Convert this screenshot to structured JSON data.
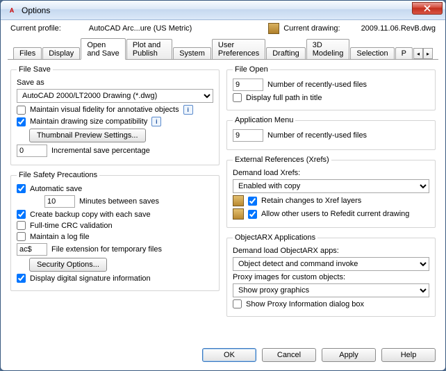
{
  "window": {
    "title": "Options"
  },
  "profile": {
    "current_label": "Current profile:",
    "current_value": "AutoCAD Arc...ure (US Metric)",
    "drawing_label": "Current drawing:",
    "drawing_value": "2009.11.06.RevB.dwg"
  },
  "tabs": {
    "files": "Files",
    "display": "Display",
    "open_save": "Open and Save",
    "plot_publish": "Plot and Publish",
    "system": "System",
    "user_prefs": "User Preferences",
    "drafting": "Drafting",
    "modeling3d": "3D Modeling",
    "selection": "Selection",
    "p": "P"
  },
  "file_save": {
    "legend": "File Save",
    "save_as_label": "Save as",
    "format": "AutoCAD 2000/LT2000 Drawing (*.dwg)",
    "maintain_visual": "Maintain visual fidelity for annotative objects",
    "maintain_size": "Maintain drawing size compatibility",
    "thumbnail_btn": "Thumbnail Preview Settings...",
    "incremental_value": "0",
    "incremental_label": "Incremental save percentage"
  },
  "file_safety": {
    "legend": "File Safety Precautions",
    "auto_save": "Automatic save",
    "minutes_value": "10",
    "minutes_label": "Minutes between saves",
    "backup": "Create backup copy with each save",
    "crc": "Full-time CRC validation",
    "logfile": "Maintain a log file",
    "ext_value": "ac$",
    "ext_label": "File extension for temporary files",
    "security_btn": "Security Options...",
    "signature": "Display digital signature information"
  },
  "file_open": {
    "legend": "File Open",
    "recent_value": "9",
    "recent_label": "Number of recently-used files",
    "full_path": "Display full path in title"
  },
  "app_menu": {
    "legend": "Application Menu",
    "recent_value": "9",
    "recent_label": "Number of recently-used files"
  },
  "xrefs": {
    "legend": "External References (Xrefs)",
    "demand_label": "Demand load Xrefs:",
    "demand_value": "Enabled with copy",
    "retain": "Retain changes to Xref layers",
    "allow_refedit": "Allow other users to Refedit current drawing"
  },
  "arx": {
    "legend": "ObjectARX Applications",
    "demand_label": "Demand load ObjectARX apps:",
    "demand_value": "Object detect and command invoke",
    "proxy_label": "Proxy images for custom objects:",
    "proxy_value": "Show proxy graphics",
    "show_dialog": "Show Proxy Information dialog box"
  },
  "footer": {
    "ok": "OK",
    "cancel": "Cancel",
    "apply": "Apply",
    "help": "Help"
  },
  "checked": {
    "maintain_visual": false,
    "maintain_size": true,
    "auto_save": true,
    "backup": true,
    "crc": false,
    "logfile": false,
    "signature": true,
    "full_path": false,
    "retain": true,
    "allow_refedit": true,
    "show_dialog": false
  }
}
